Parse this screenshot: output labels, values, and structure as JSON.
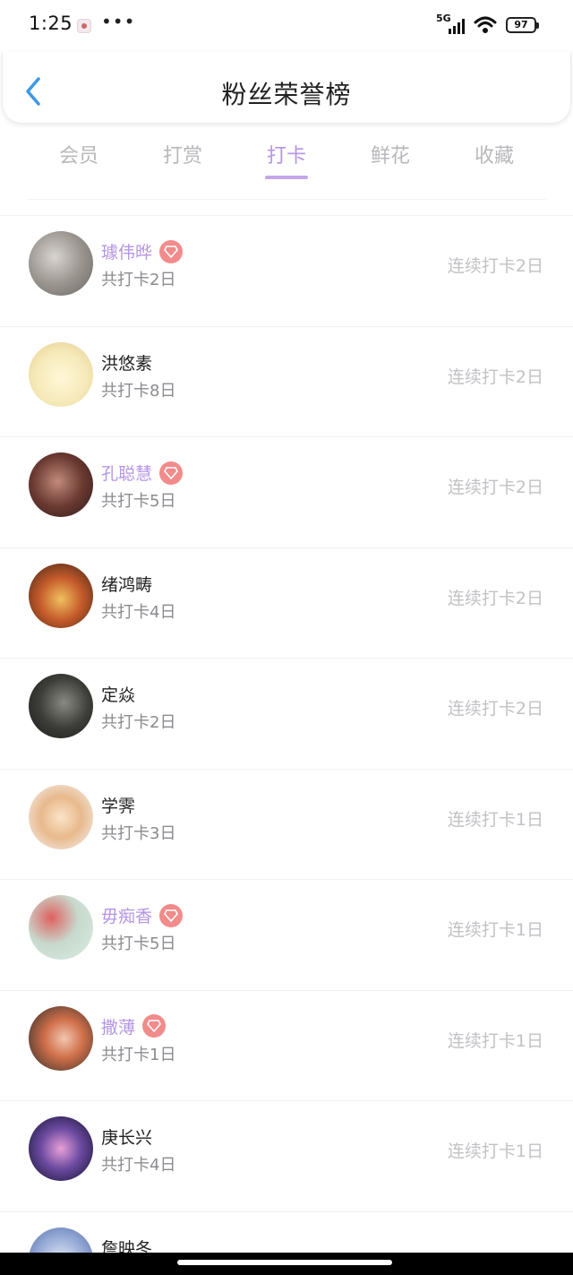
{
  "status_bar": {
    "time": "1:25",
    "more": "•••",
    "network": "5G",
    "battery": "97"
  },
  "header": {
    "back_icon": "chevron-left-icon",
    "title": "粉丝荣誉榜"
  },
  "tabs": [
    {
      "label": "会员",
      "active": false
    },
    {
      "label": "打赏",
      "active": false
    },
    {
      "label": "打卡",
      "active": true
    },
    {
      "label": "鲜花",
      "active": false
    },
    {
      "label": "收藏",
      "active": false
    }
  ],
  "colors": {
    "accent": "#b596e4",
    "vip_badge": "#f28b8b",
    "muted": "#c2c2c6"
  },
  "fans": [
    {
      "name": "璩伟晔",
      "vip": true,
      "total": "共打卡2日",
      "streak": "连续打卡2日"
    },
    {
      "name": "洪悠素",
      "vip": false,
      "total": "共打卡8日",
      "streak": "连续打卡2日"
    },
    {
      "name": "孔聪慧",
      "vip": true,
      "total": "共打卡5日",
      "streak": "连续打卡2日"
    },
    {
      "name": "绪鸿畴",
      "vip": false,
      "total": "共打卡4日",
      "streak": "连续打卡2日"
    },
    {
      "name": "定焱",
      "vip": false,
      "total": "共打卡2日",
      "streak": "连续打卡2日"
    },
    {
      "name": "学霁",
      "vip": false,
      "total": "共打卡3日",
      "streak": "连续打卡1日"
    },
    {
      "name": "毋痴香",
      "vip": true,
      "total": "共打卡5日",
      "streak": "连续打卡1日"
    },
    {
      "name": "撒薄",
      "vip": true,
      "total": "共打卡1日",
      "streak": "连续打卡1日"
    },
    {
      "name": "庚长兴",
      "vip": false,
      "total": "共打卡4日",
      "streak": "连续打卡1日"
    },
    {
      "name": "詹映冬",
      "vip": false,
      "total": "",
      "streak": ""
    }
  ]
}
